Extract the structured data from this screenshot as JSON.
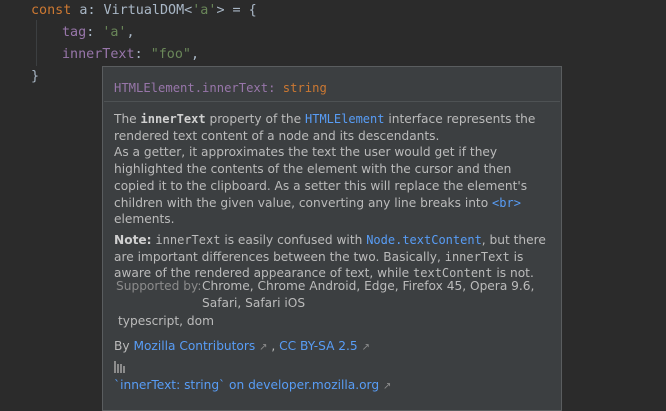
{
  "editor": {
    "line1": {
      "kw": "const",
      "var": " a",
      "rest": ": VirtualDOM<",
      "str": "'a'",
      "end": "> = {"
    },
    "line2": {
      "prop": "tag",
      "colon": ": ",
      "str": "'a'",
      "comma": ","
    },
    "line3": {
      "prop": "innerText",
      "colon": ": ",
      "str": "\"foo\"",
      "comma": ","
    },
    "line4": {
      "brace": "}"
    }
  },
  "doc": {
    "signature": {
      "cls": "HTMLElement",
      "member": ".innerText",
      "colon": ": ",
      "type": "string"
    },
    "p1": {
      "t1": "The ",
      "b1": "innerText",
      "t2": " property of the ",
      "link1": "HTMLElement",
      "t3": " interface represents the rendered text content of a node and its descendants.",
      "t4": "As a getter, it approximates the text the user would get if they highlighted the contents of the element with the cursor and then copied it to the clipboard. As a setter this will replace the element's children with the given value, converting any line breaks into ",
      "link2": "<br>",
      "t5": " elements."
    },
    "p2": {
      "b1": "Note:",
      "m1": "innerText",
      "t1": " is easily confused with ",
      "link1": "Node.textContent",
      "t2": ", but there are important differences between the two. Basically, ",
      "m2": "innerText",
      "t3": " is aware of the rendered appearance of text, while ",
      "m3": "textContent",
      "t4": " is not."
    },
    "supported_label": "Supported by:",
    "supported_value": "Chrome, Chrome Android, Edge, Firefox 45, Opera 9.6, Safari, Safari iOS",
    "tags": "typescript, dom",
    "by": {
      "prefix": "By ",
      "contributors": "Mozilla Contributors",
      "license": "CC BY-SA 2.5"
    },
    "mdn_link": "`innerText: string` on developer.mozilla.org"
  }
}
